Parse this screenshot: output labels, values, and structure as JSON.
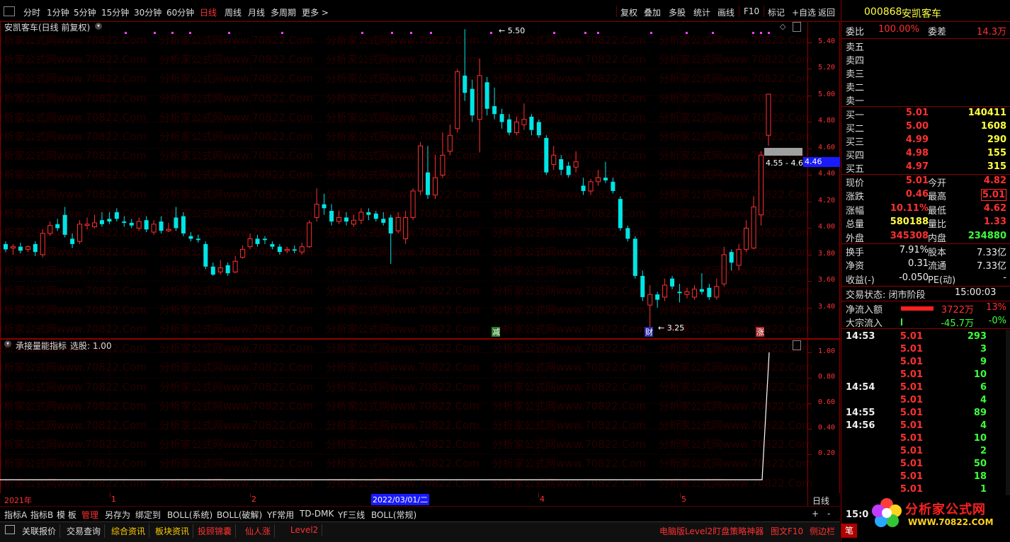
{
  "toolbar": {
    "periods": [
      "分时",
      "1分钟",
      "5分钟",
      "15分钟",
      "30分钟",
      "60分钟",
      "日线",
      "周线",
      "月线",
      "多周期",
      "更多 >"
    ],
    "active_period": "日线",
    "right_items": [
      "复权",
      "叠加",
      "多股",
      "统计",
      "画线",
      "F10",
      "标记",
      "+自选",
      "返回"
    ]
  },
  "main_chart": {
    "title": "安凯客车(日线 前复权)",
    "price_axis": [
      "5.40",
      "5.20",
      "5.00",
      "4.80",
      "4.60",
      "4.40",
      "4.20",
      "4.00",
      "3.80",
      "3.60",
      "3.40"
    ],
    "high_marker": "5.50",
    "low_marker": "3.25",
    "range_label": "4.55 - 4.6",
    "current_price_tag": "4.46",
    "event_tags": [
      "减",
      "财",
      "涨"
    ]
  },
  "indicator": {
    "title": "承接量能指标",
    "subtitle": "选股: 1.00",
    "axis": [
      "1.00",
      "0.80",
      "0.60",
      "0.40",
      "0.20"
    ]
  },
  "timeline": {
    "labels": [
      "2021年",
      "1",
      "2",
      "2022/03/01/二",
      "4",
      "5"
    ],
    "period": "日线"
  },
  "tabs_row": [
    "指标A",
    "指标B",
    "模 板",
    "管理",
    "另存为",
    "绑定到",
    "BOLL(系统)",
    "BOLL(破解)",
    "YF常用",
    "TD-DMK",
    "YF三线",
    "BOLL(常规)"
  ],
  "tabs_controls": [
    "+",
    "-"
  ],
  "bottom_row": [
    "关联报价",
    "交易查询",
    "综合资讯",
    "板块资讯",
    "投顾锦囊",
    "仙人涨",
    "Level2"
  ],
  "bottom_right": [
    "电脑版Level2盯盘策略神器",
    "图文F10",
    "侧边栏"
  ],
  "right_panel": {
    "code": "000868",
    "name": "安凯客车",
    "weibi_label": "委比",
    "weibi_value": "100.00%",
    "weicha_label": "委差",
    "weicha_value": "14.3万",
    "sell": [
      {
        "label": "卖五",
        "price": "",
        "vol": ""
      },
      {
        "label": "卖四",
        "price": "",
        "vol": ""
      },
      {
        "label": "卖三",
        "price": "",
        "vol": ""
      },
      {
        "label": "卖二",
        "price": "",
        "vol": ""
      },
      {
        "label": "卖一",
        "price": "",
        "vol": ""
      }
    ],
    "buy": [
      {
        "label": "买一",
        "price": "5.01",
        "vol": "140411"
      },
      {
        "label": "买二",
        "price": "5.00",
        "vol": "1608"
      },
      {
        "label": "买三",
        "price": "4.99",
        "vol": "290"
      },
      {
        "label": "买四",
        "price": "4.98",
        "vol": "155"
      },
      {
        "label": "买五",
        "price": "4.97",
        "vol": "315"
      }
    ],
    "stats": [
      {
        "l1": "现价",
        "v1": "5.01",
        "l2": "今开",
        "v2": "4.82"
      },
      {
        "l1": "涨跌",
        "v1": "0.46",
        "l2": "最高",
        "v2": "5.01"
      },
      {
        "l1": "涨幅",
        "v1": "10.11%",
        "l2": "最低",
        "v2": "4.62"
      },
      {
        "l1": "总量",
        "v1": "580188",
        "l2": "量比",
        "v2": "1.33"
      },
      {
        "l1": "外盘",
        "v1": "345308",
        "l2": "内盘",
        "v2": "234880"
      }
    ],
    "stats2": [
      {
        "l1": "换手",
        "v1": "7.91%",
        "l2": "股本",
        "v2": "7.33亿"
      },
      {
        "l1": "净资",
        "v1": "0.31",
        "l2": "流通",
        "v2": "7.33亿"
      },
      {
        "l1": "收益(-)",
        "v1": "-0.050",
        "l2": "PE(动)",
        "v2": "-"
      }
    ],
    "status_label": "交易状态: 闭市阶段",
    "status_time": "15:00:03",
    "flow": [
      {
        "label": "净流入额",
        "value": "3722万",
        "pct": "13%"
      },
      {
        "label": "大宗流入",
        "value": "-45.7万",
        "pct": "-0%"
      }
    ],
    "ticks": [
      {
        "time": "14:53",
        "price": "5.01",
        "vol": "293"
      },
      {
        "time": "",
        "price": "5.01",
        "vol": "3"
      },
      {
        "time": "",
        "price": "5.01",
        "vol": "9"
      },
      {
        "time": "",
        "price": "5.01",
        "vol": "10"
      },
      {
        "time": "14:54",
        "price": "5.01",
        "vol": "6"
      },
      {
        "time": "",
        "price": "5.01",
        "vol": "4"
      },
      {
        "time": "14:55",
        "price": "5.01",
        "vol": "89"
      },
      {
        "time": "14:56",
        "price": "5.01",
        "vol": "4"
      },
      {
        "time": "",
        "price": "5.01",
        "vol": "10"
      },
      {
        "time": "",
        "price": "5.01",
        "vol": "2"
      },
      {
        "time": "",
        "price": "5.01",
        "vol": "50"
      },
      {
        "time": "",
        "price": "5.01",
        "vol": "18"
      },
      {
        "time": "",
        "price": "5.01",
        "vol": "1"
      }
    ],
    "tick_partial_time": "15:0",
    "bottom_tab": "笔"
  },
  "watermark_text": "分析家公式网www.70822.Com",
  "logo": {
    "title": "分析家公式网",
    "url": "WWW.70822.COM"
  },
  "colors": {
    "up": "#ff3030",
    "down": "#00e5e5",
    "axis": "#ff3333",
    "border": "#8b0000"
  },
  "candles": [
    {
      "o": 3.88,
      "c": 3.84,
      "h": 3.9,
      "l": 3.82
    },
    {
      "o": 3.85,
      "c": 3.86,
      "h": 3.88,
      "l": 3.8
    },
    {
      "o": 3.86,
      "c": 3.83,
      "h": 3.89,
      "l": 3.81
    },
    {
      "o": 3.84,
      "c": 3.86,
      "h": 3.87,
      "l": 3.82
    },
    {
      "o": 3.88,
      "c": 3.82,
      "h": 3.9,
      "l": 3.79
    },
    {
      "o": 3.8,
      "c": 3.96,
      "h": 3.99,
      "l": 3.78
    },
    {
      "o": 3.96,
      "c": 4.02,
      "h": 4.05,
      "l": 3.94
    },
    {
      "o": 4.03,
      "c": 4.0,
      "h": 4.07,
      "l": 3.98
    },
    {
      "o": 4.1,
      "c": 3.95,
      "h": 4.16,
      "l": 3.93
    },
    {
      "o": 3.92,
      "c": 3.88,
      "h": 3.96,
      "l": 3.85
    },
    {
      "o": 3.9,
      "c": 4.03,
      "h": 4.06,
      "l": 3.88
    },
    {
      "o": 4.02,
      "c": 4.03,
      "h": 4.08,
      "l": 3.99
    },
    {
      "o": 4.01,
      "c": 4.04,
      "h": 4.1,
      "l": 4.0
    },
    {
      "o": 4.06,
      "c": 4.03,
      "h": 4.12,
      "l": 4.01
    },
    {
      "o": 4.07,
      "c": 4.05,
      "h": 4.12,
      "l": 4.03
    },
    {
      "o": 4.12,
      "c": 4.07,
      "h": 4.15,
      "l": 4.05
    },
    {
      "o": 4.05,
      "c": 4.04,
      "h": 4.09,
      "l": 4.01
    },
    {
      "o": 4.04,
      "c": 4.02,
      "h": 4.07,
      "l": 4.0
    },
    {
      "o": 4.0,
      "c": 4.05,
      "h": 4.08,
      "l": 3.98
    },
    {
      "o": 4.06,
      "c": 3.99,
      "h": 4.09,
      "l": 3.97
    },
    {
      "o": 3.97,
      "c": 4.03,
      "h": 4.06,
      "l": 3.95
    },
    {
      "o": 4.05,
      "c": 3.98,
      "h": 4.09,
      "l": 3.96
    },
    {
      "o": 3.98,
      "c": 3.99,
      "h": 4.04,
      "l": 3.97
    },
    {
      "o": 4.08,
      "c": 4.0,
      "h": 4.16,
      "l": 3.98
    },
    {
      "o": 4.09,
      "c": 3.96,
      "h": 4.12,
      "l": 3.94
    },
    {
      "o": 3.94,
      "c": 3.92,
      "h": 3.97,
      "l": 3.9
    },
    {
      "o": 3.92,
      "c": 3.91,
      "h": 3.95,
      "l": 3.89
    },
    {
      "o": 3.88,
      "c": 3.71,
      "h": 3.9,
      "l": 3.69
    },
    {
      "o": 3.71,
      "c": 3.65,
      "h": 3.74,
      "l": 3.64
    },
    {
      "o": 3.67,
      "c": 3.7,
      "h": 3.76,
      "l": 3.65
    },
    {
      "o": 3.72,
      "c": 3.66,
      "h": 3.74,
      "l": 3.64
    },
    {
      "o": 3.67,
      "c": 3.75,
      "h": 3.79,
      "l": 3.66
    },
    {
      "o": 3.78,
      "c": 3.84,
      "h": 3.87,
      "l": 3.77
    },
    {
      "o": 3.86,
      "c": 3.92,
      "h": 3.96,
      "l": 3.84
    },
    {
      "o": 3.92,
      "c": 3.88,
      "h": 3.95,
      "l": 3.86
    },
    {
      "o": 3.92,
      "c": 3.91,
      "h": 3.94,
      "l": 3.88
    },
    {
      "o": 3.88,
      "c": 3.86,
      "h": 3.9,
      "l": 3.84
    },
    {
      "o": 3.86,
      "c": 3.82,
      "h": 3.88,
      "l": 3.8
    },
    {
      "o": 3.83,
      "c": 3.84,
      "h": 3.86,
      "l": 3.81
    },
    {
      "o": 3.84,
      "c": 3.83,
      "h": 3.87,
      "l": 3.81
    },
    {
      "o": 3.82,
      "c": 3.86,
      "h": 3.89,
      "l": 3.8
    },
    {
      "o": 3.86,
      "c": 4.04,
      "h": 4.06,
      "l": 3.85
    },
    {
      "o": 4.08,
      "c": 4.18,
      "h": 4.3,
      "l": 4.05
    },
    {
      "o": 4.18,
      "c": 4.15,
      "h": 4.26,
      "l": 4.1
    },
    {
      "o": 4.13,
      "c": 4.05,
      "h": 4.18,
      "l": 4.02
    },
    {
      "o": 4.05,
      "c": 4.08,
      "h": 4.13,
      "l": 4.03
    },
    {
      "o": 4.08,
      "c": 4.05,
      "h": 4.12,
      "l": 4.02
    },
    {
      "o": 4.03,
      "c": 4.06,
      "h": 4.1,
      "l": 4.01
    },
    {
      "o": 4.06,
      "c": 4.12,
      "h": 4.15,
      "l": 4.03
    },
    {
      "o": 4.12,
      "c": 4.1,
      "h": 4.15,
      "l": 4.06
    },
    {
      "o": 4.11,
      "c": 4.07,
      "h": 4.13,
      "l": 4.05
    },
    {
      "o": 4.07,
      "c": 4.04,
      "h": 4.12,
      "l": 4.02
    },
    {
      "o": 4.08,
      "c": 3.96,
      "h": 4.1,
      "l": 3.73
    },
    {
      "o": 3.98,
      "c": 4.08,
      "h": 4.12,
      "l": 3.96
    },
    {
      "o": 3.92,
      "c": 4.08,
      "h": 4.13,
      "l": 3.88
    },
    {
      "o": 4.08,
      "c": 4.28,
      "h": 4.3,
      "l": 4.06
    },
    {
      "o": 4.28,
      "c": 4.62,
      "h": 4.65,
      "l": 4.25
    },
    {
      "o": 4.42,
      "c": 4.25,
      "h": 4.62,
      "l": 4.22
    },
    {
      "o": 4.25,
      "c": 4.38,
      "h": 4.55,
      "l": 4.22
    },
    {
      "o": 4.4,
      "c": 4.55,
      "h": 4.72,
      "l": 4.38
    },
    {
      "o": 4.58,
      "c": 4.7,
      "h": 4.78,
      "l": 4.55
    },
    {
      "o": 4.75,
      "c": 5.18,
      "h": 5.2,
      "l": 4.72
    },
    {
      "o": 5.15,
      "c": 5.02,
      "h": 5.5,
      "l": 4.96
    },
    {
      "o": 5.05,
      "c": 4.85,
      "h": 5.12,
      "l": 4.8
    },
    {
      "o": 4.82,
      "c": 5.15,
      "h": 5.28,
      "l": 4.57
    },
    {
      "o": 5.1,
      "c": 4.9,
      "h": 5.14,
      "l": 4.85
    },
    {
      "o": 4.92,
      "c": 4.86,
      "h": 5.06,
      "l": 4.82
    },
    {
      "o": 4.86,
      "c": 4.8,
      "h": 4.9,
      "l": 4.75
    },
    {
      "o": 4.82,
      "c": 4.72,
      "h": 4.86,
      "l": 4.7
    },
    {
      "o": 4.72,
      "c": 4.8,
      "h": 4.84,
      "l": 4.7
    },
    {
      "o": 4.78,
      "c": 4.82,
      "h": 4.94,
      "l": 4.74
    },
    {
      "o": 4.84,
      "c": 4.74,
      "h": 4.86,
      "l": 4.7
    },
    {
      "o": 4.8,
      "c": 4.7,
      "h": 4.82,
      "l": 4.68
    },
    {
      "o": 4.68,
      "c": 4.42,
      "h": 4.7,
      "l": 4.4
    },
    {
      "o": 4.48,
      "c": 4.55,
      "h": 4.62,
      "l": 4.44
    },
    {
      "o": 4.52,
      "c": 4.44,
      "h": 4.55,
      "l": 4.4
    },
    {
      "o": 4.47,
      "c": 4.4,
      "h": 4.5,
      "l": 4.38
    },
    {
      "o": 4.46,
      "c": 4.5,
      "h": 4.58,
      "l": 4.42
    },
    {
      "o": 4.32,
      "c": 4.28,
      "h": 4.38,
      "l": 4.25
    },
    {
      "o": 4.28,
      "c": 4.35,
      "h": 4.37,
      "l": 4.25
    },
    {
      "o": 4.35,
      "c": 4.38,
      "h": 4.44,
      "l": 4.32
    },
    {
      "o": 4.38,
      "c": 4.36,
      "h": 4.5,
      "l": 4.34
    },
    {
      "o": 4.35,
      "c": 4.28,
      "h": 4.38,
      "l": 4.26
    },
    {
      "o": 4.22,
      "c": 4.0,
      "h": 4.24,
      "l": 3.98
    },
    {
      "o": 4.0,
      "c": 3.92,
      "h": 4.02,
      "l": 3.9
    },
    {
      "o": 3.92,
      "c": 3.64,
      "h": 3.94,
      "l": 3.62
    },
    {
      "o": 3.64,
      "c": 3.48,
      "h": 3.68,
      "l": 3.45
    },
    {
      "o": 3.42,
      "c": 3.5,
      "h": 3.57,
      "l": 3.25
    },
    {
      "o": 3.5,
      "c": 3.46,
      "h": 3.52,
      "l": 3.4
    },
    {
      "o": 3.48,
      "c": 3.57,
      "h": 3.62,
      "l": 3.45
    },
    {
      "o": 3.62,
      "c": 3.56,
      "h": 3.64,
      "l": 3.54
    },
    {
      "o": 3.52,
      "c": 3.51,
      "h": 3.58,
      "l": 3.44
    },
    {
      "o": 3.5,
      "c": 3.52,
      "h": 3.55,
      "l": 3.47
    },
    {
      "o": 3.48,
      "c": 3.54,
      "h": 3.57,
      "l": 3.46
    },
    {
      "o": 3.54,
      "c": 3.52,
      "h": 3.66,
      "l": 3.5
    },
    {
      "o": 3.55,
      "c": 3.48,
      "h": 3.58,
      "l": 3.46
    },
    {
      "o": 3.48,
      "c": 3.56,
      "h": 3.62,
      "l": 3.46
    },
    {
      "o": 3.58,
      "c": 3.8,
      "h": 3.86,
      "l": 3.56
    },
    {
      "o": 3.82,
      "c": 3.74,
      "h": 3.84,
      "l": 3.68
    },
    {
      "o": 3.72,
      "c": 3.84,
      "h": 3.88,
      "l": 3.68
    },
    {
      "o": 3.84,
      "c": 4.0,
      "h": 4.06,
      "l": 3.82
    },
    {
      "o": 3.85,
      "c": 4.16,
      "h": 4.24,
      "l": 3.84
    },
    {
      "o": 4.1,
      "c": 4.55,
      "h": 4.58,
      "l": 4.02
    },
    {
      "o": 4.7,
      "c": 5.01,
      "h": 5.01,
      "l": 4.62
    }
  ]
}
